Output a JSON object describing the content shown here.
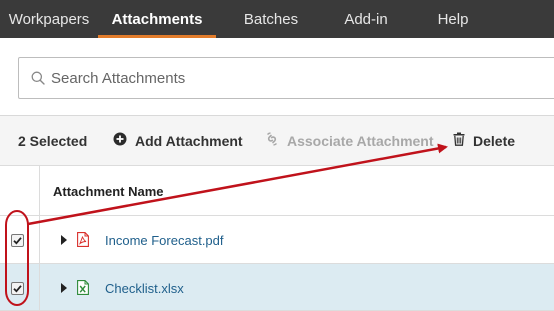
{
  "nav": {
    "tabs": [
      {
        "label": "Workpapers"
      },
      {
        "label": "Attachments"
      },
      {
        "label": "Batches"
      },
      {
        "label": "Add-in"
      },
      {
        "label": "Help"
      }
    ],
    "active_tab": "Attachments",
    "accent_color": "#e27c2b"
  },
  "search": {
    "placeholder": "Search Attachments",
    "value": "",
    "icon": "search-icon"
  },
  "toolbar": {
    "selected_label": "2 Selected",
    "add_label": "Add Attachment",
    "add_icon": "plus-circle-icon",
    "associate_label": "Associate Attachment",
    "associate_icon": "link-icon",
    "delete_label": "Delete",
    "delete_icon": "trash-icon"
  },
  "table": {
    "header": {
      "name": "Attachment Name"
    },
    "rows": [
      {
        "name": "Income Forecast.pdf",
        "type": "pdf",
        "icon": "pdf-file-icon",
        "checked": true
      },
      {
        "name": "Checklist.xlsx",
        "type": "xlsx",
        "icon": "excel-file-icon",
        "checked": true
      }
    ]
  },
  "annotation": {
    "color": "#c0121b"
  }
}
